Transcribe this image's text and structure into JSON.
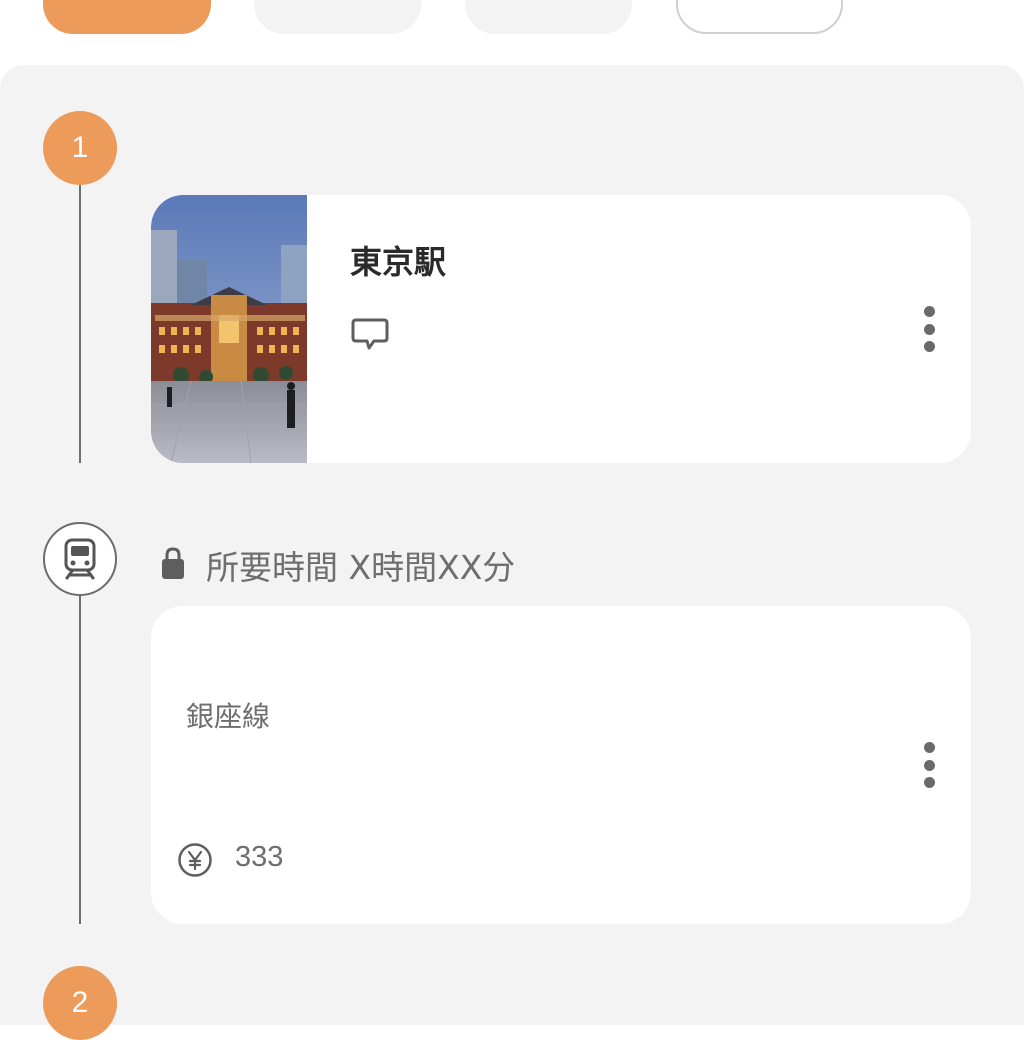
{
  "tabs": [
    {
      "state": "selected"
    },
    {
      "state": "normal"
    },
    {
      "state": "normal"
    },
    {
      "state": "outlined"
    }
  ],
  "timeline": {
    "stop1": {
      "number": "1",
      "place": {
        "title": "東京駅",
        "photo_subject": "Tokyo Station building at dusk"
      }
    },
    "transit": {
      "mode_icon": "train-icon",
      "duration": "所要時間 X時間XX分",
      "line": "銀座線",
      "fare": "333"
    },
    "stop2": {
      "number": "2"
    }
  },
  "icons": {
    "comment": "comment-icon",
    "more": "more-vertical-icon",
    "lock": "lock-icon",
    "fare": "yen-icon"
  },
  "colors": {
    "accent": "#ec9b5a",
    "panel": "#f3f3f3",
    "text_secondary": "#6e6e6e",
    "text_primary": "#2a2a2a"
  }
}
